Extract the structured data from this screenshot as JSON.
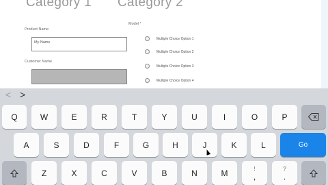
{
  "form": {
    "category1": "Category 1",
    "category2": "Category 2",
    "product_name_label": "Product Name",
    "product_name_value": "My Name",
    "customer_name_label": "Customer Name",
    "model_label": "Model *",
    "options": [
      "Multiple Choice Option 1",
      "Multiple Choice Option 2",
      "Multiple Choice Option 3",
      "Multiple Choice Option 4"
    ]
  },
  "toolbar": {
    "prev": "<",
    "next": ">"
  },
  "keyboard": {
    "row1": [
      "Q",
      "W",
      "E",
      "R",
      "T",
      "Y",
      "U",
      "I",
      "O",
      "P"
    ],
    "row2": [
      "A",
      "S",
      "D",
      "F",
      "G",
      "H",
      "J",
      "K",
      "L"
    ],
    "row3": [
      "Z",
      "X",
      "C",
      "V",
      "B",
      "N",
      "M"
    ],
    "go_label": "Go",
    "comma_top": "!",
    "comma_bottom": ",",
    "period_top": "?",
    "period_bottom": ".",
    "icons": {
      "delete": "backspace-icon",
      "shift": "shift-icon"
    }
  },
  "colors": {
    "go_key": "#1a84e8",
    "keyboard_bg": "#d4d7dc"
  }
}
